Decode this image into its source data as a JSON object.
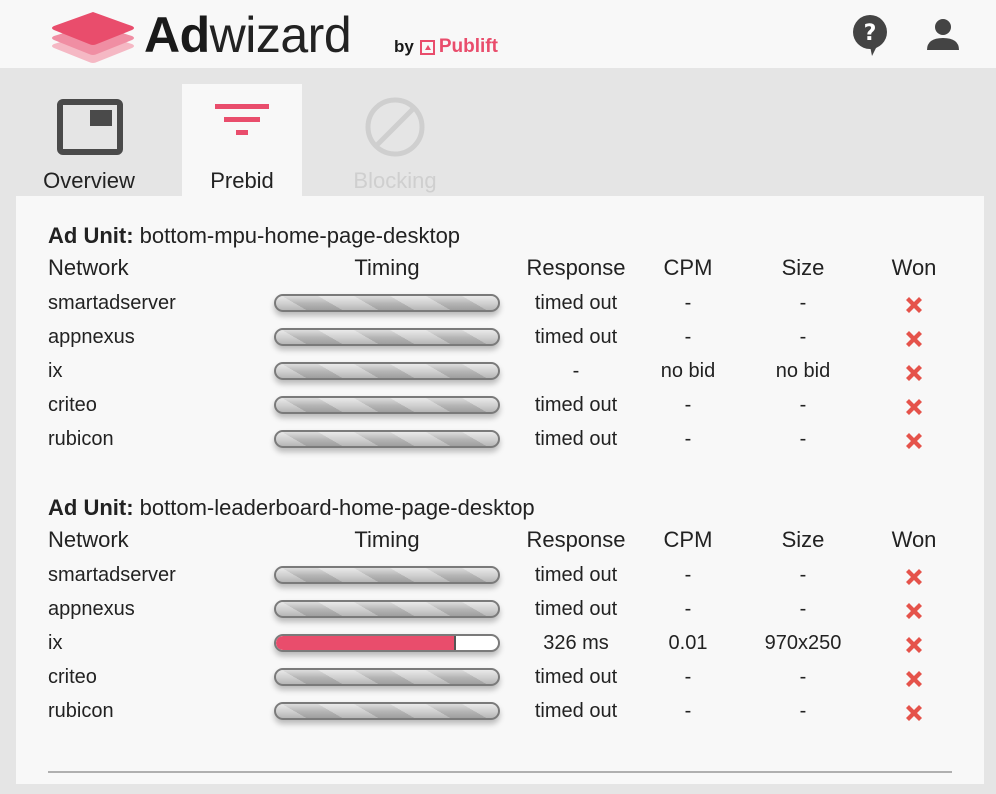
{
  "app": {
    "brand_bold": "Ad",
    "brand_light": "wizard",
    "by_label": "by",
    "publisher": "Publift",
    "accent_color": "#e94d6c"
  },
  "header": {
    "help_icon": "help-bubble-icon",
    "user_icon": "user-account-icon"
  },
  "tabs": [
    {
      "label": "Overview",
      "icon": "overview-window-icon",
      "state": "normal"
    },
    {
      "label": "Prebid",
      "icon": "filter-funnel-icon",
      "state": "active"
    },
    {
      "label": "Blocking",
      "icon": "block-circle-icon",
      "state": "disabled"
    }
  ],
  "table_headers": {
    "network": "Network",
    "timing": "Timing",
    "response": "Response",
    "cpm": "CPM",
    "size": "Size",
    "won": "Won"
  },
  "ad_units": [
    {
      "label": "Ad Unit:",
      "name": "bottom-mpu-home-page-desktop",
      "rows": [
        {
          "network": "smartadserver",
          "timing_state": "timed-out",
          "timing_fraction": 1.0,
          "response": "timed out",
          "cpm": "-",
          "size": "-",
          "won": false
        },
        {
          "network": "appnexus",
          "timing_state": "timed-out",
          "timing_fraction": 1.0,
          "response": "timed out",
          "cpm": "-",
          "size": "-",
          "won": false
        },
        {
          "network": "ix",
          "timing_state": "timed-out",
          "timing_fraction": 1.0,
          "response": "-",
          "cpm": "no bid",
          "size": "no bid",
          "won": false
        },
        {
          "network": "criteo",
          "timing_state": "timed-out",
          "timing_fraction": 1.0,
          "response": "timed out",
          "cpm": "-",
          "size": "-",
          "won": false
        },
        {
          "network": "rubicon",
          "timing_state": "timed-out",
          "timing_fraction": 1.0,
          "response": "timed out",
          "cpm": "-",
          "size": "-",
          "won": false
        }
      ]
    },
    {
      "label": "Ad Unit:",
      "name": "bottom-leaderboard-home-page-desktop",
      "rows": [
        {
          "network": "smartadserver",
          "timing_state": "timed-out",
          "timing_fraction": 1.0,
          "response": "timed out",
          "cpm": "-",
          "size": "-",
          "won": false
        },
        {
          "network": "appnexus",
          "timing_state": "timed-out",
          "timing_fraction": 1.0,
          "response": "timed out",
          "cpm": "-",
          "size": "-",
          "won": false
        },
        {
          "network": "ix",
          "timing_state": "responded",
          "timing_fraction": 0.81,
          "response": "326 ms",
          "cpm": "0.01",
          "size": "970x250",
          "won": false
        },
        {
          "network": "criteo",
          "timing_state": "timed-out",
          "timing_fraction": 1.0,
          "response": "timed out",
          "cpm": "-",
          "size": "-",
          "won": false
        },
        {
          "network": "rubicon",
          "timing_state": "timed-out",
          "timing_fraction": 1.0,
          "response": "timed out",
          "cpm": "-",
          "size": "-",
          "won": false
        }
      ]
    }
  ]
}
